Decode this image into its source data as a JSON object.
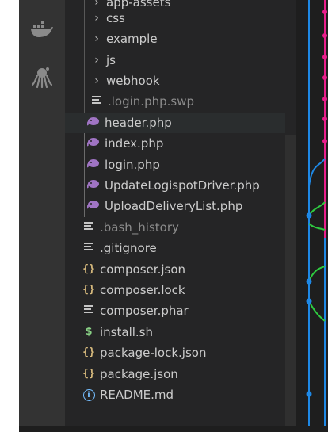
{
  "activity_bar": {
    "icons": [
      "docker-icon",
      "octopus-icon"
    ]
  },
  "explorer": {
    "items": [
      {
        "label": "app-assets",
        "type": "folder"
      },
      {
        "label": "css",
        "type": "folder"
      },
      {
        "label": "example",
        "type": "folder"
      },
      {
        "label": "js",
        "type": "folder"
      },
      {
        "label": "webhook",
        "type": "folder"
      },
      {
        "label": ".login.php.swp",
        "type": "lines"
      },
      {
        "label": "header.php",
        "type": "php"
      },
      {
        "label": "index.php",
        "type": "php"
      },
      {
        "label": "login.php",
        "type": "php"
      },
      {
        "label": "UpdateLogispotDriver.php",
        "type": "php"
      },
      {
        "label": "UploadDeliveryList.php",
        "type": "php"
      },
      {
        "label": ".bash_history",
        "type": "lines"
      },
      {
        "label": ".gitignore",
        "type": "lines"
      },
      {
        "label": "composer.json",
        "type": "json"
      },
      {
        "label": "composer.lock",
        "type": "json"
      },
      {
        "label": "composer.phar",
        "type": "lines"
      },
      {
        "label": "install.sh",
        "type": "shell"
      },
      {
        "label": "package-lock.json",
        "type": "json"
      },
      {
        "label": "package.json",
        "type": "json"
      },
      {
        "label": "README.md",
        "type": "info"
      }
    ]
  },
  "icons": {
    "json_glyph": "{}",
    "shell_glyph": "$",
    "info_glyph": "i",
    "chevron_glyph": "›"
  },
  "colors": {
    "background": "#252526",
    "activity_bar": "#333333",
    "text": "#cccccc",
    "dim_text": "#8c8c8c",
    "php_icon": "#a074c4",
    "json_icon": "#d7ba7d",
    "shell_icon": "#89d185",
    "info_icon": "#75beff",
    "graph_blue": "#1e88e5",
    "graph_magenta": "#e91e8c",
    "graph_green": "#2ecc40"
  }
}
